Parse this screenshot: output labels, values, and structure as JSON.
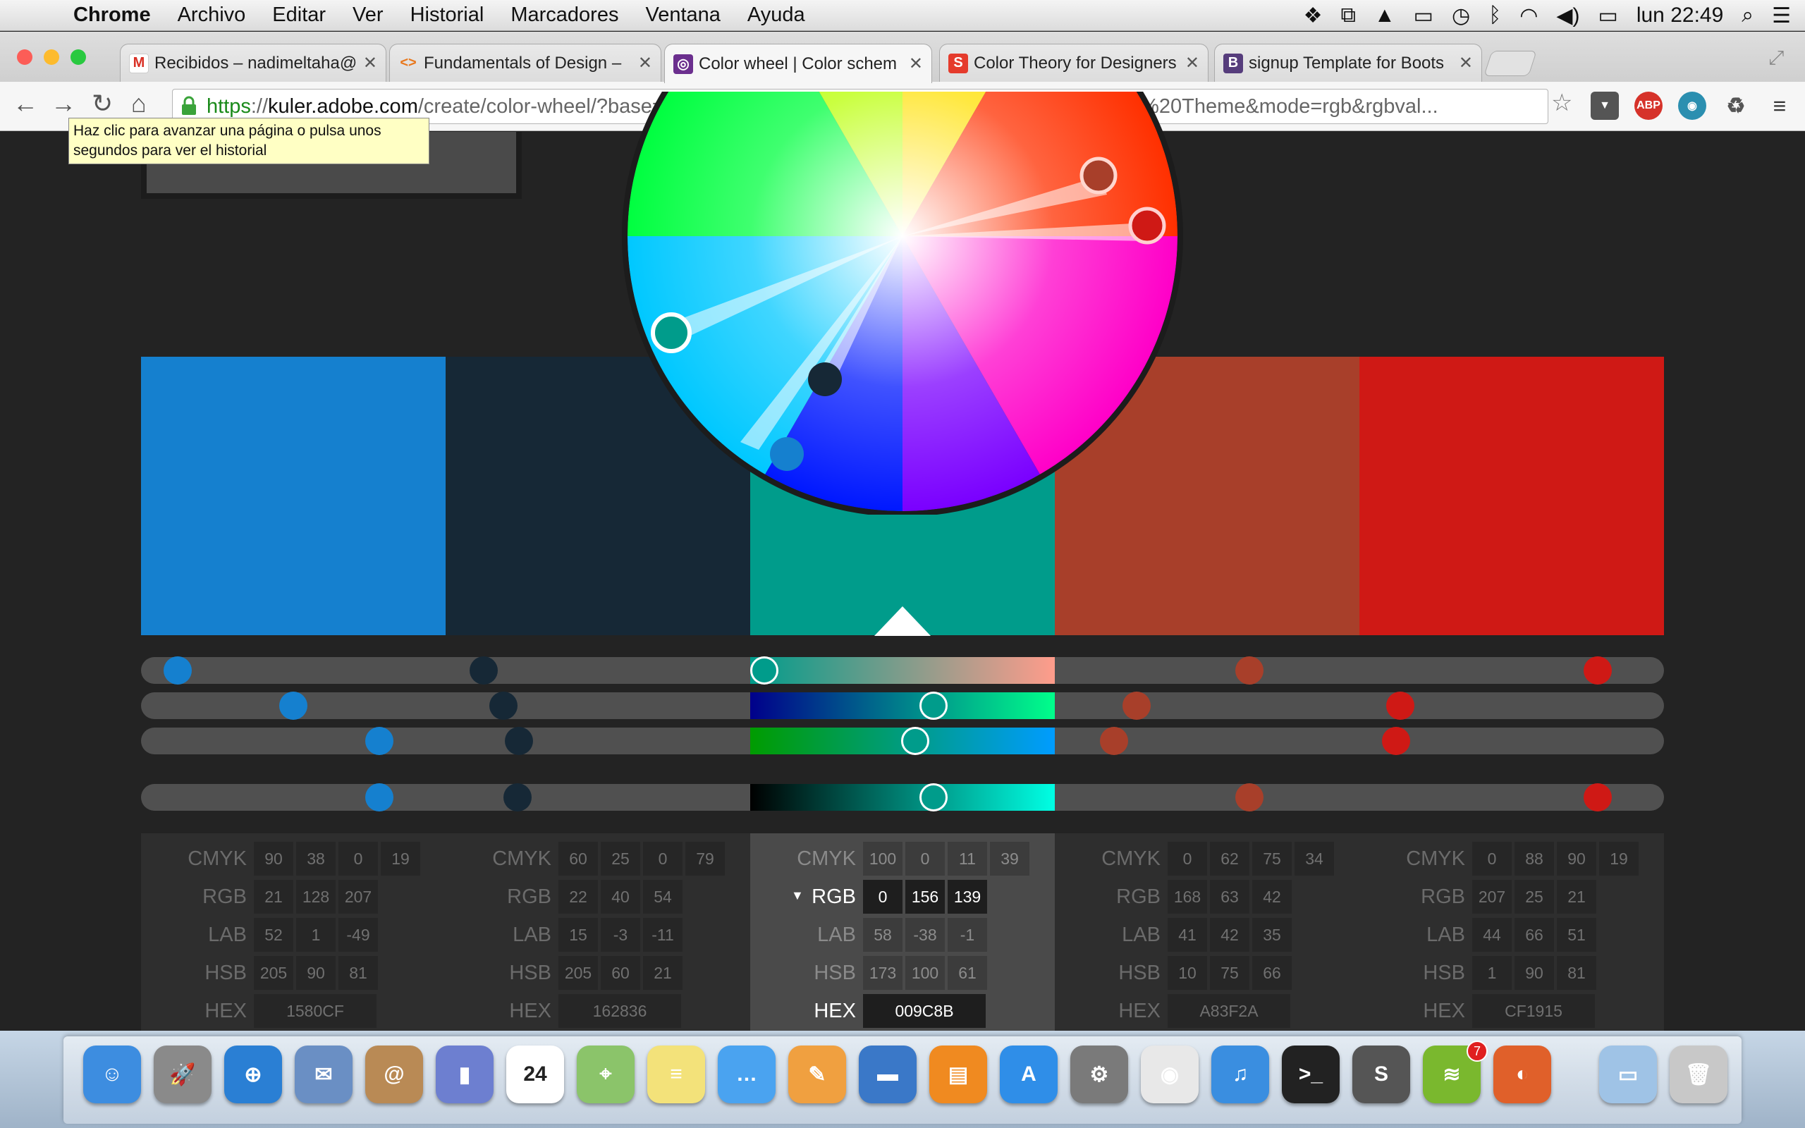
{
  "menubar": {
    "app": "Chrome",
    "items": [
      "Archivo",
      "Editar",
      "Ver",
      "Historial",
      "Marcadores",
      "Ventana",
      "Ayuda"
    ],
    "clock": "lun 22:49",
    "status_icons": [
      "dropbox-icon",
      "window-icon",
      "drive-icon",
      "airplay-icon",
      "time-machine-icon",
      "bluetooth-icon",
      "wifi-icon",
      "volume-icon",
      "battery-icon",
      "spotlight-icon",
      "notification-center-icon"
    ]
  },
  "tabs": [
    {
      "title": "Recibidos – nadimeltaha@",
      "favicon": "gmail-icon",
      "color": "#d93025"
    },
    {
      "title": "Fundamentals of Design –",
      "favicon": "code-icon",
      "color": "#e8771c"
    },
    {
      "title": "Color wheel | Color schem",
      "favicon": "kuler-icon",
      "color": "#6b2f8e"
    },
    {
      "title": "Color Theory for Designers",
      "favicon": "smashing-icon",
      "color": "#e53b2c"
    },
    {
      "title": "signup Template for Boots",
      "favicon": "bootstrap-icon",
      "color": "#563d7c"
    }
  ],
  "address": {
    "scheme": "https",
    "sep": "://",
    "host": "kuler.adobe.com",
    "path": "/create/color-wheel/?base=2&rule=Compound&selected=2&name=My%20Kuler%20Theme&mode=rgb&rgbval..."
  },
  "tooltip": "Haz clic para avanzar una página o pulsa unos segundos para ver el historial",
  "swatches": [
    {
      "hex": "#1580CF"
    },
    {
      "hex": "#162836"
    },
    {
      "hex": "#009C8B"
    },
    {
      "hex": "#A83F2A"
    },
    {
      "hex": "#CF1915"
    }
  ],
  "labels": {
    "cmyk": "CMYK",
    "rgb": "RGB",
    "lab": "LAB",
    "hsb": "HSB",
    "hex": "HEX",
    "caret": "▼"
  },
  "panels": [
    {
      "cmyk": [
        "90",
        "38",
        "0",
        "19"
      ],
      "rgb": [
        "21",
        "128",
        "207"
      ],
      "lab": [
        "52",
        "1",
        "-49"
      ],
      "hsb": [
        "205",
        "90",
        "81"
      ],
      "hex": "1580CF"
    },
    {
      "cmyk": [
        "60",
        "25",
        "0",
        "79"
      ],
      "rgb": [
        "22",
        "40",
        "54"
      ],
      "lab": [
        "15",
        "-3",
        "-11"
      ],
      "hsb": [
        "205",
        "60",
        "21"
      ],
      "hex": "162836"
    },
    {
      "cmyk": [
        "100",
        "0",
        "11",
        "39"
      ],
      "rgb": [
        "0",
        "156",
        "139"
      ],
      "lab": [
        "58",
        "-38",
        "-1"
      ],
      "hsb": [
        "173",
        "100",
        "61"
      ],
      "hex": "009C8B"
    },
    {
      "cmyk": [
        "0",
        "62",
        "75",
        "34"
      ],
      "rgb": [
        "168",
        "63",
        "42"
      ],
      "lab": [
        "41",
        "42",
        "35"
      ],
      "hsb": [
        "10",
        "75",
        "66"
      ],
      "hex": "A83F2A"
    },
    {
      "cmyk": [
        "0",
        "88",
        "90",
        "19"
      ],
      "rgb": [
        "207",
        "25",
        "21"
      ],
      "lab": [
        "44",
        "66",
        "51"
      ],
      "hsb": [
        "1",
        "90",
        "81"
      ],
      "hex": "CF1915"
    }
  ],
  "dock": [
    {
      "name": "finder-icon",
      "color": "#3d8de0"
    },
    {
      "name": "launchpad-icon",
      "color": "#8a8a8a"
    },
    {
      "name": "safari-icon",
      "color": "#2a7fd4"
    },
    {
      "name": "mail-icon",
      "color": "#6a8fc4"
    },
    {
      "name": "contacts-icon",
      "color": "#b98a55"
    },
    {
      "name": "keynote-chart-icon",
      "color": "#6d7fd0"
    },
    {
      "name": "calendar-icon",
      "color": "#ffffff",
      "text": "24"
    },
    {
      "name": "maps-icon",
      "color": "#8bc46a"
    },
    {
      "name": "notes-icon",
      "color": "#f3e27a"
    },
    {
      "name": "messages-icon",
      "color": "#4aa3f0"
    },
    {
      "name": "pages-icon",
      "color": "#f0a040"
    },
    {
      "name": "keynote-icon",
      "color": "#3a78c8"
    },
    {
      "name": "ibooks-icon",
      "color": "#f08a20"
    },
    {
      "name": "app-store-icon",
      "color": "#2f8ee8"
    },
    {
      "name": "system-preferences-icon",
      "color": "#7a7a7a"
    },
    {
      "name": "chrome-icon",
      "color": "#e8e8e8"
    },
    {
      "name": "itunes-icon",
      "color": "#3a8ee0"
    },
    {
      "name": "terminal-icon",
      "color": "#222222"
    },
    {
      "name": "sublime-text-icon",
      "color": "#555555"
    },
    {
      "name": "spotify-icon",
      "color": "#7ab82e",
      "badge": "7"
    },
    {
      "name": "firefox-icon",
      "color": "#e0602a"
    },
    {
      "name": "downloads-folder-icon",
      "color": "#9fc3e6"
    },
    {
      "name": "trash-icon",
      "color": "#c8c8c8"
    }
  ]
}
